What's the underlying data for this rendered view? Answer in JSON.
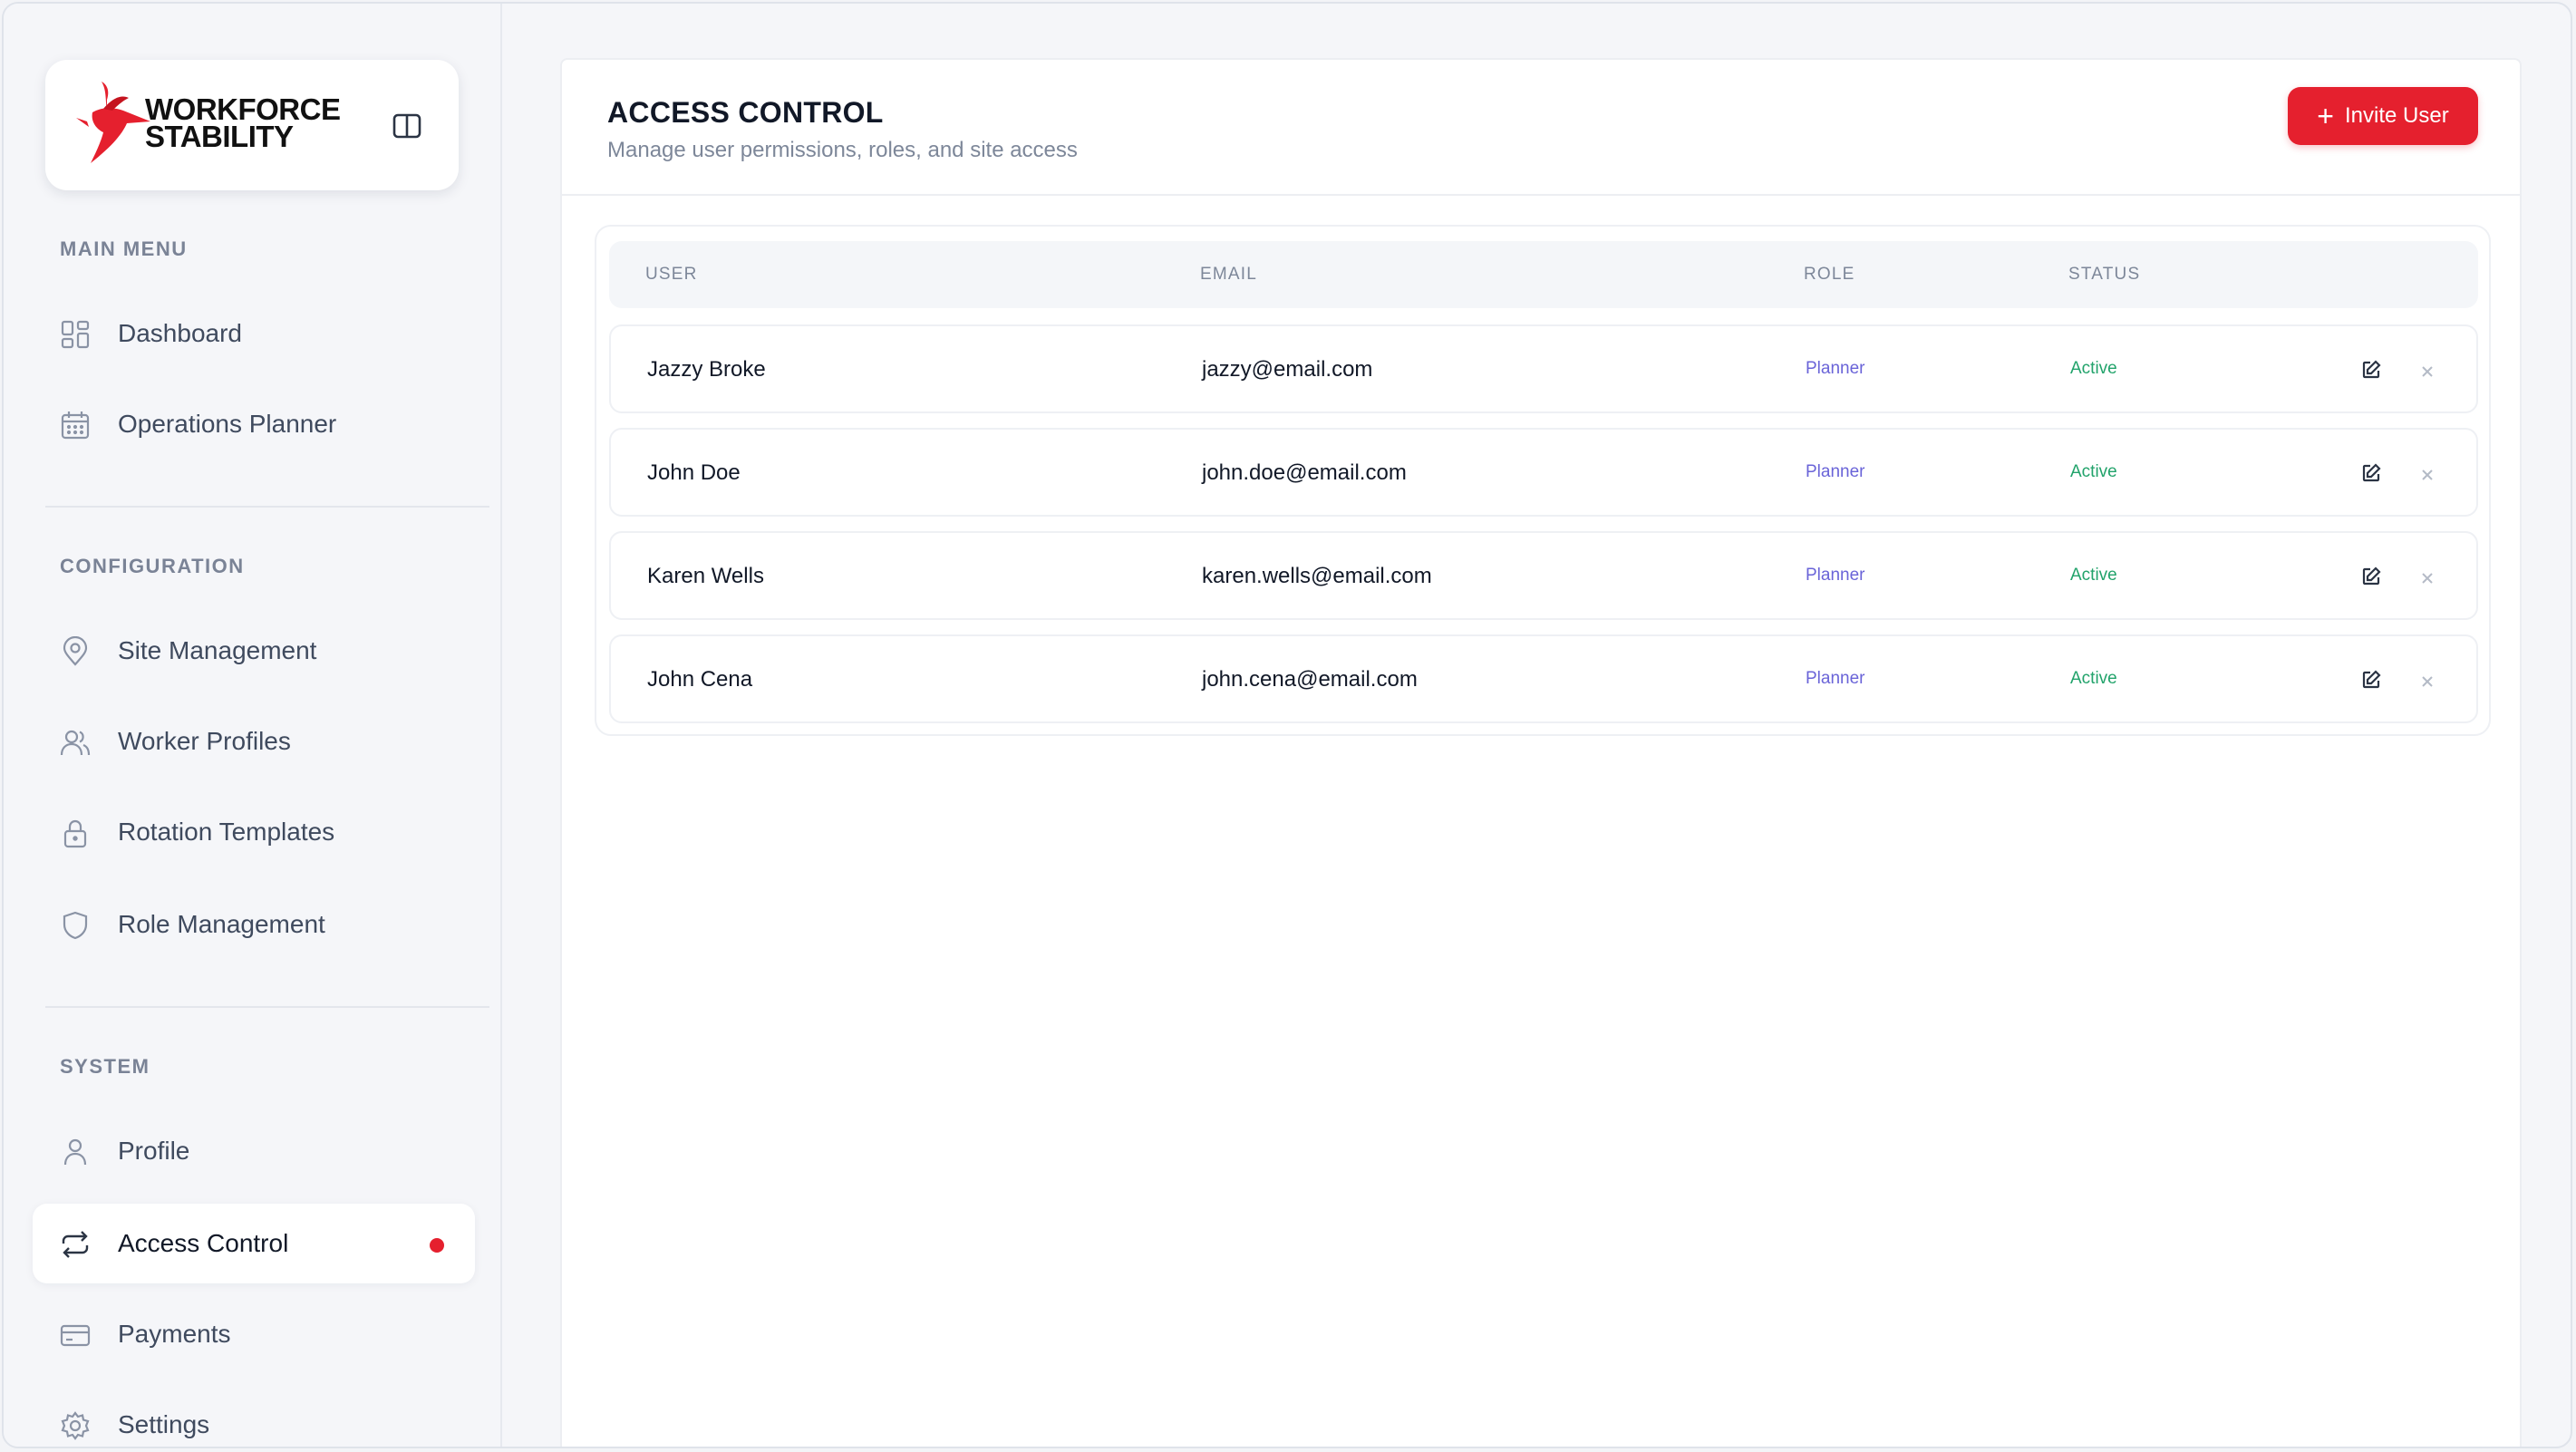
{
  "brand": {
    "name": "WORKFORCE\nSTABILITY",
    "accent": "#e5202e"
  },
  "sidebar": {
    "sections": [
      {
        "label": "MAIN MENU",
        "items": [
          {
            "label": "Dashboard",
            "icon": "dashboard-icon"
          },
          {
            "label": "Operations Planner",
            "icon": "calendar-icon"
          }
        ]
      },
      {
        "label": "CONFIGURATION",
        "items": [
          {
            "label": "Site Management",
            "icon": "map-pin-icon"
          },
          {
            "label": "Worker Profiles",
            "icon": "users-icon"
          },
          {
            "label": "Rotation Templates",
            "icon": "lock-icon"
          },
          {
            "label": "Role Management",
            "icon": "shield-icon"
          }
        ]
      },
      {
        "label": "SYSTEM",
        "items": [
          {
            "label": "Profile",
            "icon": "user-icon"
          },
          {
            "label": "Access Control",
            "icon": "repeat-icon",
            "active": true
          },
          {
            "label": "Payments",
            "icon": "credit-card-icon"
          },
          {
            "label": "Settings",
            "icon": "gear-icon"
          }
        ]
      }
    ]
  },
  "header": {
    "title": "ACCESS CONTROL",
    "subtitle": "Manage user permissions, roles, and site access",
    "invite_label": "Invite User"
  },
  "table": {
    "columns": [
      "USER",
      "EMAIL",
      "ROLE",
      "STATUS"
    ],
    "rows": [
      {
        "user": "Jazzy Broke",
        "email": "jazzy@email.com",
        "role": "Planner",
        "status": "Active"
      },
      {
        "user": "John Doe",
        "email": "john.doe@email.com",
        "role": "Planner",
        "status": "Active"
      },
      {
        "user": "Karen Wells",
        "email": "karen.wells@email.com",
        "role": "Planner",
        "status": "Active"
      },
      {
        "user": "John Cena",
        "email": "john.cena@email.com",
        "role": "Planner",
        "status": "Active"
      }
    ]
  },
  "colors": {
    "role": "#6a64d8",
    "status": "#22a36b",
    "primary_button": "#e5202e"
  }
}
